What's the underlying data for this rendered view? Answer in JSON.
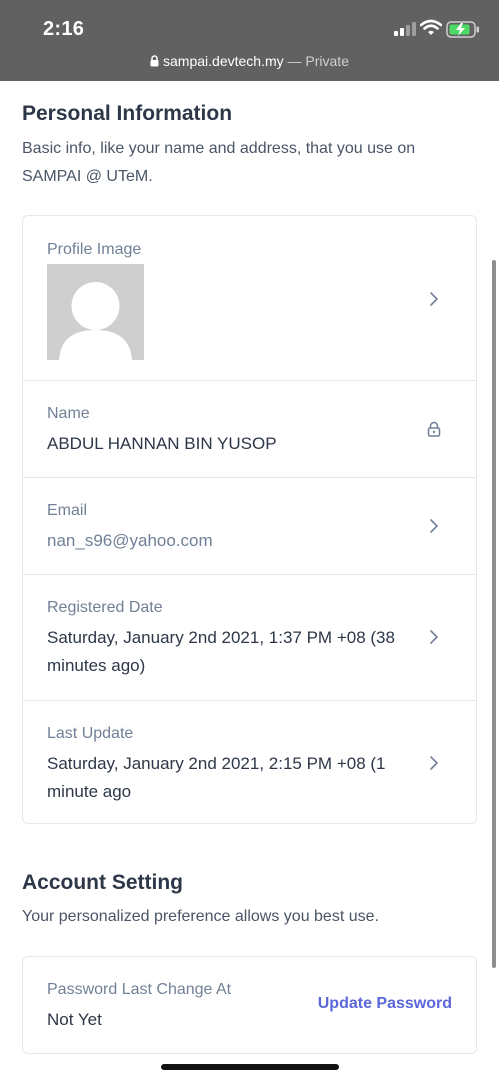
{
  "status": {
    "time": "2:16",
    "url": "sampai.devtech.my",
    "private": "— Private"
  },
  "personal": {
    "title": "Personal Information",
    "description": "Basic info, like your name and address, that you use on SAMPAI @ UTeM.",
    "profile_label": "Profile Image",
    "name_label": "Name",
    "name_value": "ABDUL HANNAN BIN YUSOP",
    "email_label": "Email",
    "email_value": "nan_s96@yahoo.com",
    "registered_label": "Registered Date",
    "registered_value": "Saturday, January 2nd 2021, 1:37 PM +08 (38 minutes ago)",
    "update_label": "Last Update",
    "update_value": "Saturday, January 2nd 2021, 2:15 PM +08 (1 minute ago"
  },
  "account": {
    "title": "Account Setting",
    "description": "Your personalized preference allows you best use.",
    "password_label": "Password Last Change At",
    "password_value": "Not Yet",
    "update_password": "Update Password"
  },
  "icons": [
    "lock-icon",
    "chevron-right-icon",
    "wifi-icon",
    "battery-icon",
    "signal-icon"
  ],
  "colors": {
    "topbar": "#616161",
    "link": "#5a67d8",
    "border": "#e2e8f0"
  }
}
